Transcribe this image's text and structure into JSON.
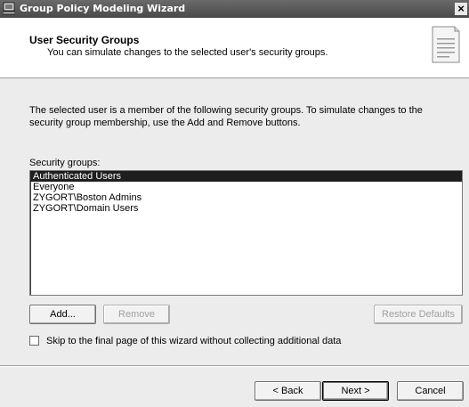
{
  "window": {
    "title": "Group Policy Modeling Wizard",
    "close_glyph": "×"
  },
  "header": {
    "title": "User Security Groups",
    "subtitle": "You can simulate changes to the selected user's security groups.",
    "icon": "document-icon"
  },
  "main": {
    "intro": "The selected user is a member of the following security groups. To simulate changes to the security group membership, use the Add and Remove buttons.",
    "groups_label": "Security groups:",
    "groups": [
      "Authenticated Users",
      "Everyone",
      "ZYGORT\\Boston Admins",
      "ZYGORT\\Domain Users"
    ],
    "selected_index": 0,
    "add_label": "Add...",
    "remove_label": "Remove",
    "restore_label": "Restore Defaults",
    "skip_label": "Skip to the final page of this wizard without collecting additional data",
    "skip_checked": false
  },
  "footer": {
    "back_label": "< Back",
    "next_label": "Next >",
    "cancel_label": "Cancel"
  },
  "colors": {
    "selection": "#1e1e1e",
    "titlebar": "#4a4a4a"
  }
}
